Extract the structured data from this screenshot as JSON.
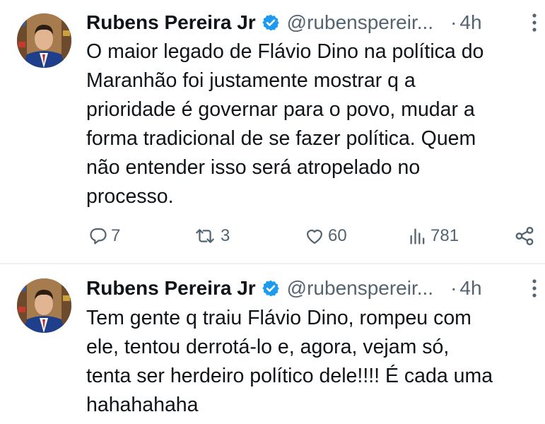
{
  "tweets": [
    {
      "author_name": "Rubens Pereira Jr",
      "handle": "@rubenspereir...",
      "separator": "·",
      "time": "4h",
      "text_lines": [
        "O maior legado de Flávio Dino na política do",
        "Maranhão foi justamente mostrar q a",
        "prioridade é governar para o povo, mudar a",
        "forma tradicional de se fazer política. Quem",
        "não entender isso será atropelado no",
        "processo."
      ],
      "replies": "7",
      "retweets": "3",
      "likes": "60",
      "views": "781"
    },
    {
      "author_name": "Rubens Pereira Jr",
      "handle": "@rubenspereir...",
      "separator": "·",
      "time": "4h",
      "text_lines": [
        "Tem gente q traiu Flávio Dino, rompeu com",
        "ele, tentou derrotá-lo e, agora, vejam só,",
        "tenta ser herdeiro político dele!!!! É cada uma",
        "hahahahaha"
      ]
    }
  ],
  "icons": {
    "verified": "verified-badge-icon",
    "more": "more-vertical-icon",
    "reply": "reply-icon",
    "retweet": "retweet-icon",
    "like": "heart-icon",
    "views": "views-chart-icon",
    "share": "share-icon"
  },
  "colors": {
    "text": "#0f1419",
    "muted": "#536471",
    "verified": "#1d9bf0",
    "divider": "#eff3f4"
  }
}
